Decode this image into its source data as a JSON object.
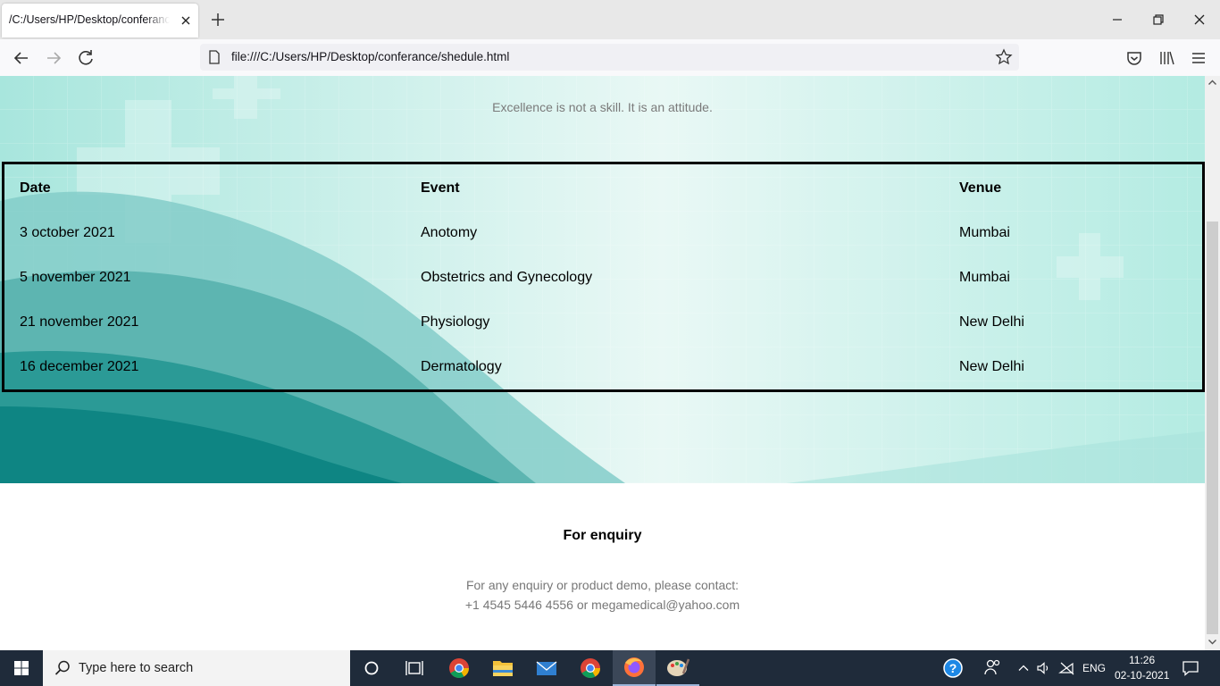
{
  "browser": {
    "tab_title": "/C:/Users/HP/Desktop/conferance/shedule.html",
    "url": "file:///C:/Users/HP/Desktop/conferance/shedule.html"
  },
  "page": {
    "quote": "Excellence is not a skill. It is an attitude.",
    "schedule": {
      "headers": {
        "date": "Date",
        "event": "Event",
        "venue": "Venue"
      },
      "rows": [
        {
          "date": "3 october 2021",
          "event": "Anotomy",
          "venue": "Mumbai"
        },
        {
          "date": "5 november 2021",
          "event": "Obstetrics and Gynecology",
          "venue": "Mumbai"
        },
        {
          "date": "21 november 2021",
          "event": "Physiology",
          "venue": "New Delhi"
        },
        {
          "date": "16 december 2021",
          "event": "Dermatology",
          "venue": "New Delhi"
        }
      ]
    },
    "enquiry": {
      "title": "For enquiry",
      "line1": "For any enquiry or product demo, please contact:",
      "line2": "+1 4545 5446 4556 or megamedical@yahoo.com"
    }
  },
  "taskbar": {
    "search_placeholder": "Type here to search",
    "language": "ENG",
    "time": "11:26",
    "date": "02-10-2021"
  },
  "colors": {
    "teal_dark": "#0e8f8c",
    "teal_light": "#a8e6dd",
    "taskbar": "#1f2b3a"
  },
  "icons": [
    "close-icon",
    "plus-icon",
    "minimize-icon",
    "restore-icon",
    "back-arrow-icon",
    "forward-arrow-icon",
    "reload-icon",
    "page-icon",
    "star-icon",
    "pocket-icon",
    "library-icon",
    "hamburger-menu-icon",
    "windows-start-icon",
    "search-icon",
    "cortana-icon",
    "task-view-icon",
    "chrome-icon",
    "file-explorer-icon",
    "mail-icon",
    "firefox-icon",
    "paint-icon",
    "help-icon",
    "people-icon",
    "chevron-up-icon",
    "speaker-icon",
    "network-icon",
    "notification-icon"
  ]
}
